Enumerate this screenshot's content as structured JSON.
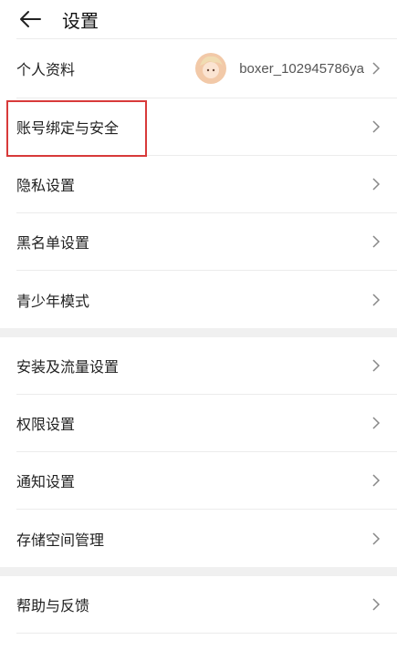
{
  "header": {
    "title": "设置"
  },
  "profile": {
    "label": "个人资料",
    "username": "boxer_102945786ya"
  },
  "group1": [
    {
      "key": "account",
      "label": "账号绑定与安全"
    },
    {
      "key": "privacy",
      "label": "隐私设置"
    },
    {
      "key": "blacklist",
      "label": "黑名单设置"
    },
    {
      "key": "teen",
      "label": "青少年模式"
    }
  ],
  "group2": [
    {
      "key": "install",
      "label": "安装及流量设置"
    },
    {
      "key": "permission",
      "label": "权限设置"
    },
    {
      "key": "notify",
      "label": "通知设置"
    },
    {
      "key": "storage",
      "label": "存储空间管理"
    }
  ],
  "group3": [
    {
      "key": "help",
      "label": "帮助与反馈"
    }
  ],
  "colors": {
    "highlight": "#d83a3a",
    "divider": "#ececec",
    "section_gap": "#f0f0f0"
  },
  "icons": {
    "back": "arrow-left-icon",
    "chevron": "chevron-right-icon"
  }
}
